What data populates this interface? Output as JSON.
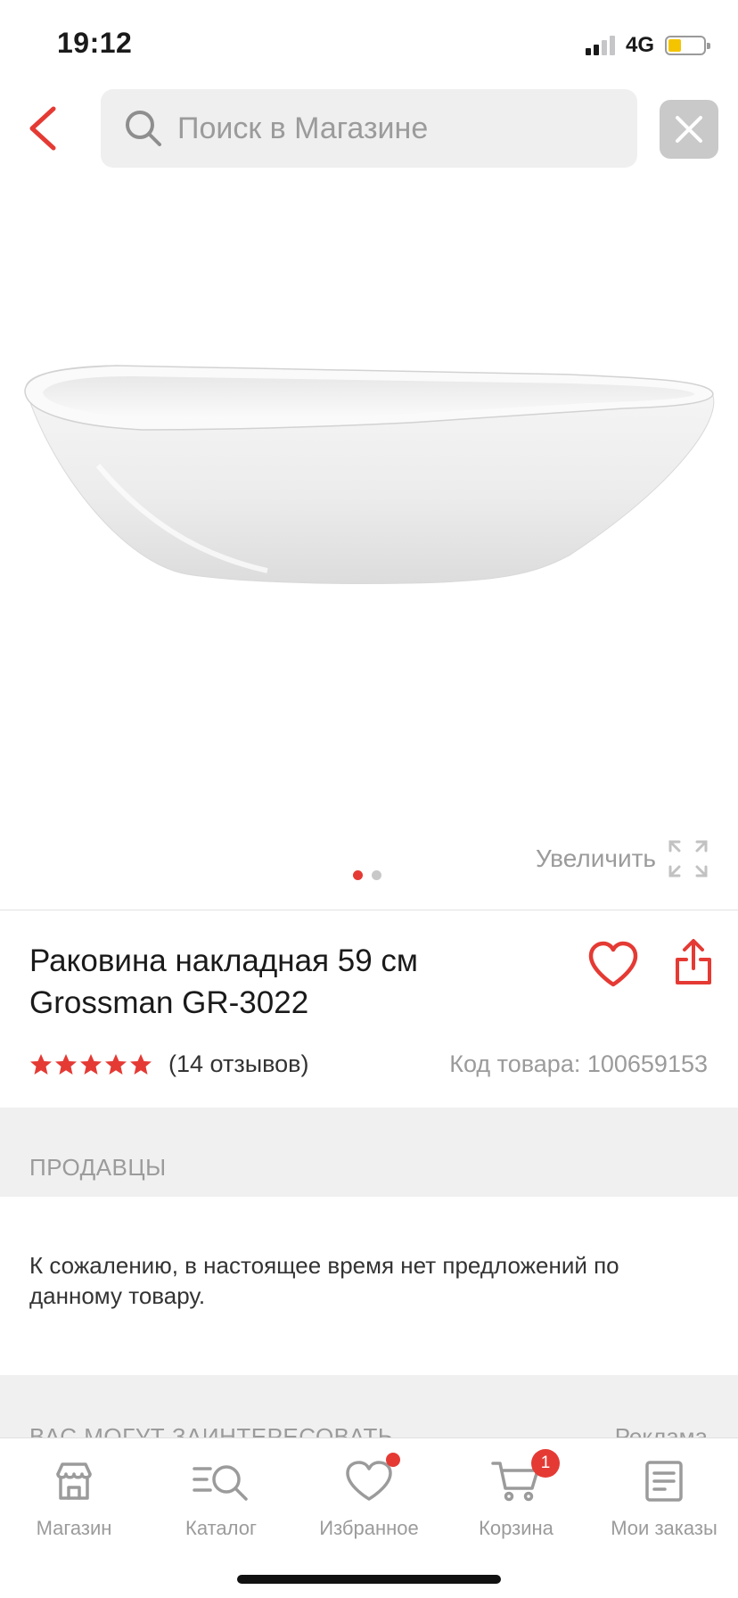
{
  "status_bar": {
    "time": "19:12",
    "network": "4G"
  },
  "header": {
    "search_placeholder": "Поиск в Магазине",
    "back_icon": "chevron-left-icon",
    "close_icon": "close-icon"
  },
  "gallery": {
    "zoom_label": "Увеличить",
    "image_count": 2,
    "active_index": 0
  },
  "product": {
    "title_line1": "Раковина накладная 59 см",
    "title_line2": "Grossman GR-3022",
    "rating_stars": 5,
    "reviews_text": "(14 отзывов)",
    "sku_text": "Код товара: 100659153"
  },
  "sellers": {
    "title": "ПРОДАВЦЫ",
    "empty_text": "К сожалению, в настоящее время нет предложений по данному товару."
  },
  "recommendations": {
    "title": "ВАС МОГУТ ЗАИНТЕРЕСОВАТЬ",
    "ad_label": "Реклама"
  },
  "tab_bar": {
    "items": [
      {
        "label": "Магазин",
        "icon": "store-icon"
      },
      {
        "label": "Каталог",
        "icon": "catalog-search-icon"
      },
      {
        "label": "Избранное",
        "icon": "heart-icon",
        "has_dot": true
      },
      {
        "label": "Корзина",
        "icon": "cart-icon",
        "badge": "1"
      },
      {
        "label": "Мои заказы",
        "icon": "orders-icon"
      }
    ]
  },
  "colors": {
    "accent": "#e53a34",
    "muted_text": "#9b9b9b",
    "band_gray": "#f0f0f0"
  }
}
